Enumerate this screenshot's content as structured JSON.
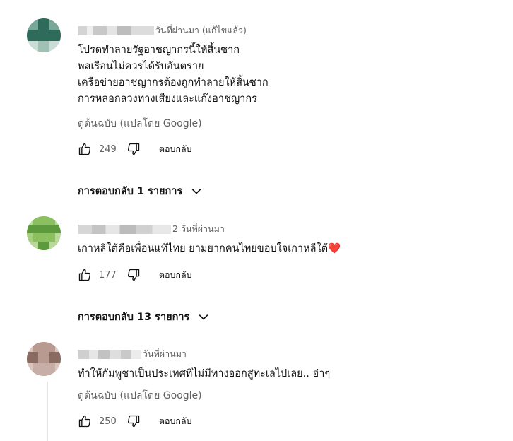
{
  "comments": [
    {
      "time": "วันที่ผ่านมา (แก้ไขแล้ว)",
      "lines": [
        "โปรดทำลายรัฐอาชญากรนี้ให้สิ้นซาก",
        "พลเรือนไม่ควรได้รับอันตราย",
        "เครือข่ายอาชญากรต้องถูกทำลายให้สิ้นซาก",
        "การหลอกลวงทางเสียงและแก๊งอาชญากร"
      ],
      "translate": "ดูต้นฉบับ (แปลโดย Google)",
      "likes": "249",
      "reply": "ตอบกลับ",
      "replies_label": "การตอบกลับ 1 รายการ",
      "avatar_colors": [
        "#2f6b5a",
        "#7aa898",
        "#c9dcd6"
      ]
    },
    {
      "time": "2 วันที่ผ่านมา",
      "lines": [
        "เกาหลีใต้คือเพื่อนแท้ไทย ยามยากคนไทยขอบใจเกาหลีใต้"
      ],
      "heart": "❤️",
      "likes": "177",
      "reply": "ตอบกลับ",
      "replies_label": "การตอบกลับ 13 รายการ",
      "avatar_colors": [
        "#5d9a3e",
        "#8cbf5f",
        "#b9d99a"
      ]
    },
    {
      "time": "วันที่ผ่านมา",
      "lines": [
        "ทำให้กัมพูชาเป็นประเทศที่ไม่มีทางออกสู่ทะเลไปเลย.. ฮ่าๆ"
      ],
      "translate": "ดูต้นฉบับ (แปลโดย Google)",
      "likes": "250",
      "reply": "ตอบกลับ",
      "avatar_colors": [
        "#8a6b62",
        "#b89a90",
        "#d9c6bf"
      ]
    }
  ],
  "icons": {
    "like": "thumb-up-icon",
    "dislike": "thumb-down-icon",
    "expand": "chevron-down-icon"
  }
}
